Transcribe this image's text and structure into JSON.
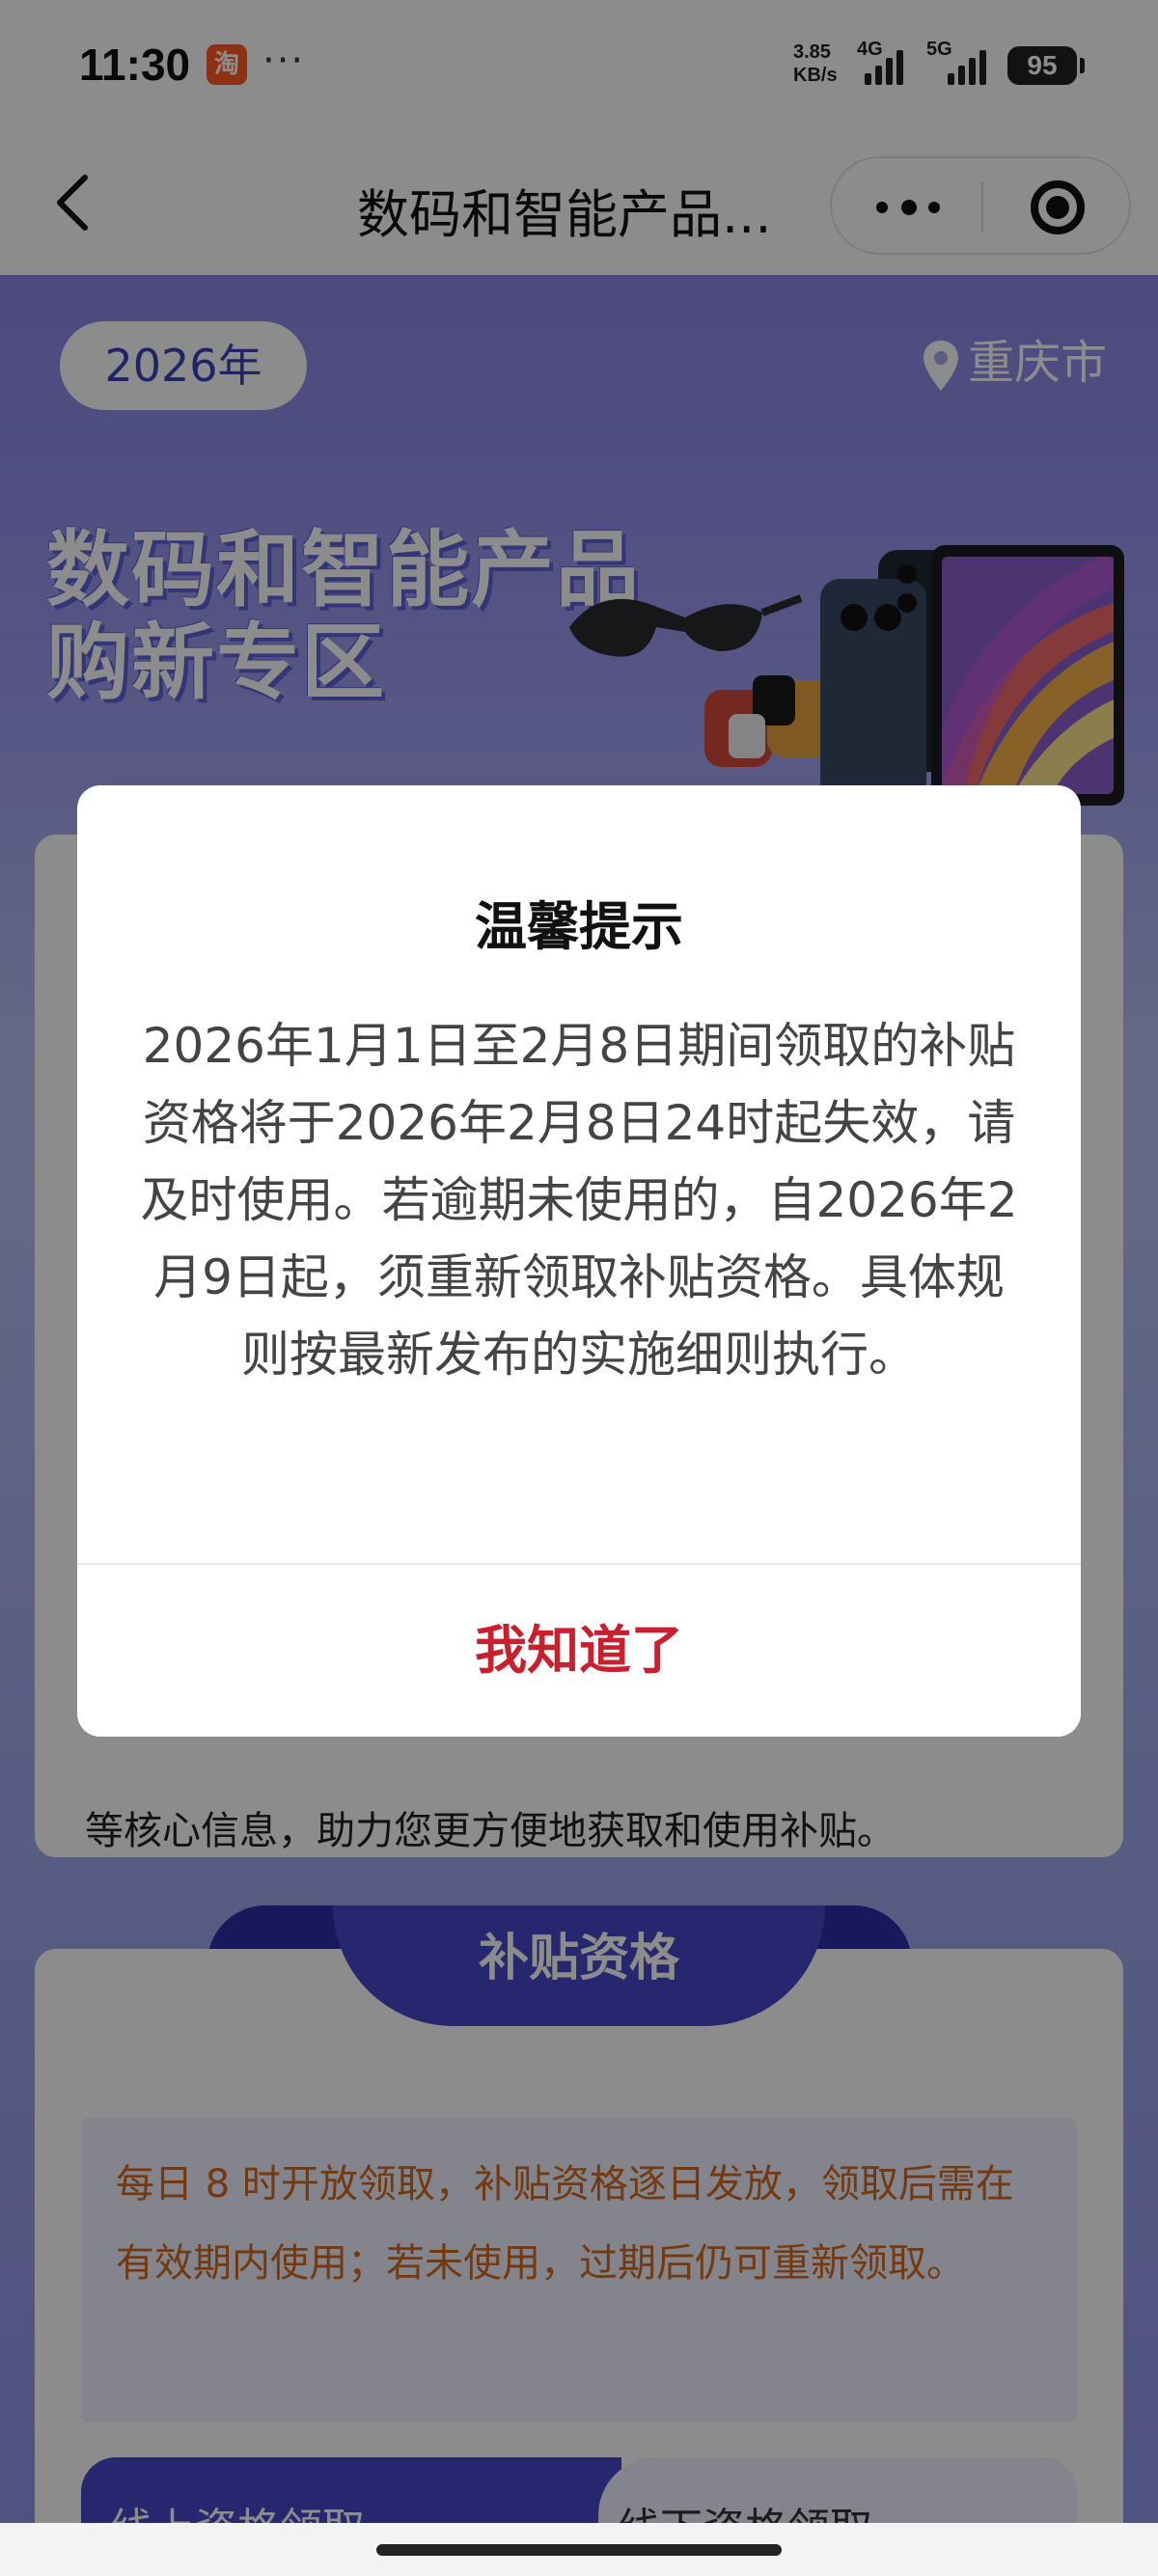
{
  "status_bar": {
    "time": "11:30",
    "app_icon": "taobao-app-icon",
    "app_icon_glyph": "淘",
    "more": "···",
    "speed_value": "3.85",
    "speed_unit": "KB/s",
    "network_1": "4G",
    "network_2": "5G",
    "battery": "95"
  },
  "nav": {
    "title": "数码和智能产品...",
    "back_icon": "chevron-left-icon",
    "more_icon": "more-dots-icon",
    "close_icon": "record-close-icon"
  },
  "page": {
    "year": "2026年",
    "location": "重庆市",
    "hero_title_line1": "数码和智能产品",
    "hero_title_line2": "购新专区",
    "intro_text": "等核心信息，助力您更方便地获取和使用补贴。",
    "qualification_tab": "补贴资格",
    "notice": "每日 8 时开放领取，补贴资格逐日发放，领取后需在有效期内使用；若未使用，过期后仍可重新领取。",
    "tab_online": "线上资格领取",
    "tab_offline": "线下资格领取"
  },
  "dialog": {
    "title": "温馨提示",
    "body": "2026年1月1日至2月8日期间领取的补贴资格将于2026年2月8日24时起失效，请及时使用。若逾期未使用的，自2026年2月9日起，须重新领取补贴资格。具体规则按最新发布的实施细则执行。",
    "confirm_label": "我知道了"
  },
  "colors": {
    "accent_red": "#c8202e",
    "brand_blue": "#4548c8",
    "notice_orange": "#d2691e"
  }
}
